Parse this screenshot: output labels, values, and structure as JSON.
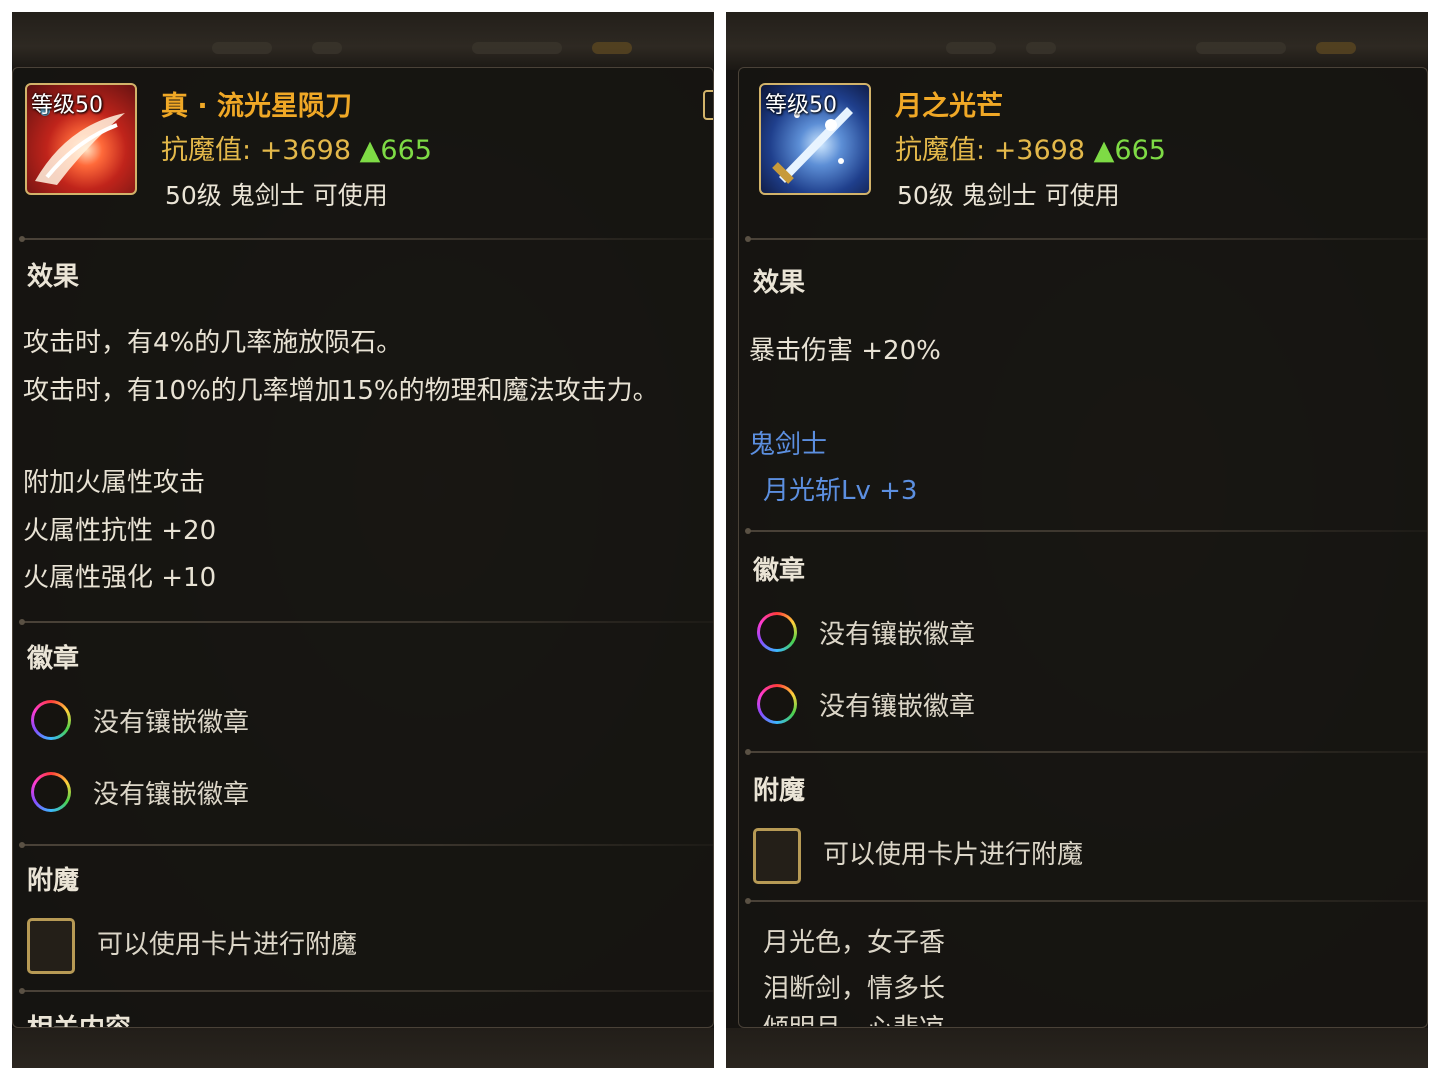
{
  "left_item": {
    "level_tag": "等级50",
    "name": "真 · 流光星陨刀",
    "anti_magic_label": "抗魔值: ",
    "anti_magic_value": "+3698",
    "anti_magic_increase": "▲665",
    "requirement": "50级 鬼剑士 可使用",
    "effect_title": "效果",
    "effects": [
      "攻击时，有4%的几率施放陨石。",
      "攻击时，有10%的几率增加15%的物理和魔法攻击力。"
    ],
    "extra_stats": [
      "附加火属性攻击",
      "火属性抗性 +20",
      "火属性强化 +10"
    ],
    "emblem_title": "徽章",
    "emblem_slots": [
      "没有镶嵌徽章",
      "没有镶嵌徽章"
    ],
    "enchant_title": "附魔",
    "enchant_text": "可以使用卡片进行附魔",
    "cut_section_title": "相关内容"
  },
  "right_item": {
    "level_tag": "等级50",
    "name": "月之光芒",
    "anti_magic_label": "抗魔值: ",
    "anti_magic_value": "+3698",
    "anti_magic_increase": "▲665",
    "requirement": "50级 鬼剑士 可使用",
    "effect_title": "效果",
    "effect": "暴击伤害 +20%",
    "class_name": "鬼剑士",
    "class_skill": "月光斩Lv +3",
    "emblem_title": "徽章",
    "emblem_slots": [
      "没有镶嵌徽章",
      "没有镶嵌徽章"
    ],
    "enchant_title": "附魔",
    "enchant_text": "可以使用卡片进行附魔",
    "flavor_lines": [
      "月光色，女子香",
      "泪断剑，情多长"
    ],
    "flavor_cut": "倾明月，心悲凉"
  },
  "colors": {
    "item_name": "#f0a826",
    "anti_magic": "#e3b84a",
    "increase": "#7edb45",
    "class_text": "#5c8fe0"
  }
}
